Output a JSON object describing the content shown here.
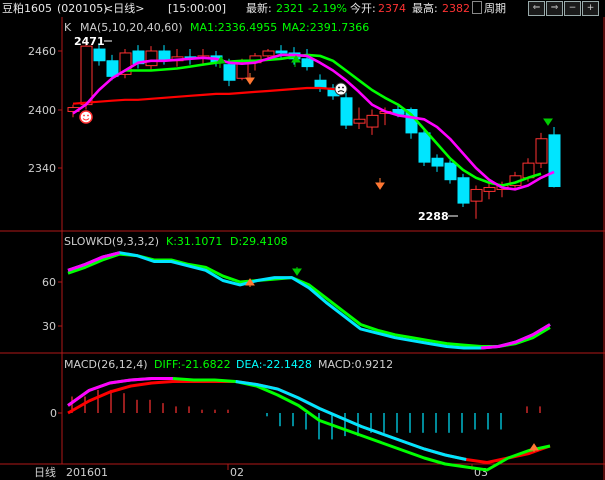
{
  "header": {
    "title": "豆粕1605",
    "code": "(020105)",
    "period": "<日线>",
    "time": "[15:00:00]",
    "latest_label": "最新:",
    "latest": "2321",
    "change": "-2.19%",
    "open_label": "今开:",
    "open": "2374",
    "high_label": "最高:",
    "high": "2382",
    "period_button": "周期"
  },
  "colors": {
    "up": "#ff3232",
    "down": "#00e5ff",
    "ma1": "#ff00ff",
    "ma2": "#ff0000",
    "ma3": "#00ff00",
    "frame": "#b01818",
    "text": "#cfcfcf",
    "green_text": "#00ff00",
    "red_text": "#ff3232"
  },
  "main_panel": {
    "legend_k": "K",
    "legend_ma": "MA(5,10,20,40,60)",
    "ma1_text": "MA1:2336.4955",
    "ma2_text": "MA2:2391.7366",
    "yticks": [
      2460,
      2400,
      2340
    ],
    "high_mark": "2471",
    "low_mark": "2288",
    "icons": [
      "smile-face-icon",
      "frown-face-icon"
    ]
  },
  "kd_panel": {
    "legend": "SLOWKD(9,3,3,2)",
    "k_text": "K:31.1071",
    "d_text": "D:29.4108",
    "yticks": [
      60,
      30
    ]
  },
  "macd_panel": {
    "legend": "MACD(26,12,4)",
    "diff_text": "DIFF:-21.6822",
    "dea_text": "DEA:-22.1428",
    "macd_text": "MACD:0.9212",
    "yticks": [
      0
    ]
  },
  "date_axis": {
    "mode_label": "日线",
    "labels": [
      "201601",
      "02",
      "03"
    ]
  },
  "chart_data": {
    "type": "candlestick",
    "candles": [
      {
        "o": 2398,
        "h": 2405,
        "l": 2392,
        "c": 2402
      },
      {
        "o": 2405,
        "h": 2471,
        "l": 2400,
        "c": 2465
      },
      {
        "o": 2462,
        "h": 2468,
        "l": 2445,
        "c": 2450
      },
      {
        "o": 2450,
        "h": 2456,
        "l": 2430,
        "c": 2434
      },
      {
        "o": 2436,
        "h": 2462,
        "l": 2432,
        "c": 2458
      },
      {
        "o": 2460,
        "h": 2466,
        "l": 2442,
        "c": 2447
      },
      {
        "o": 2445,
        "h": 2465,
        "l": 2440,
        "c": 2460
      },
      {
        "o": 2460,
        "h": 2466,
        "l": 2446,
        "c": 2450
      },
      {
        "o": 2450,
        "h": 2462,
        "l": 2444,
        "c": 2454
      },
      {
        "o": 2454,
        "h": 2462,
        "l": 2446,
        "c": 2452
      },
      {
        "o": 2453,
        "h": 2462,
        "l": 2445,
        "c": 2455
      },
      {
        "o": 2455,
        "h": 2460,
        "l": 2444,
        "c": 2448
      },
      {
        "o": 2446,
        "h": 2452,
        "l": 2424,
        "c": 2430
      },
      {
        "o": 2432,
        "h": 2452,
        "l": 2430,
        "c": 2448
      },
      {
        "o": 2448,
        "h": 2458,
        "l": 2440,
        "c": 2455
      },
      {
        "o": 2455,
        "h": 2462,
        "l": 2450,
        "c": 2460
      },
      {
        "o": 2460,
        "h": 2466,
        "l": 2452,
        "c": 2458
      },
      {
        "o": 2458,
        "h": 2464,
        "l": 2446,
        "c": 2452
      },
      {
        "o": 2452,
        "h": 2462,
        "l": 2440,
        "c": 2444
      },
      {
        "o": 2430,
        "h": 2436,
        "l": 2418,
        "c": 2422
      },
      {
        "o": 2422,
        "h": 2426,
        "l": 2410,
        "c": 2414
      },
      {
        "o": 2412,
        "h": 2418,
        "l": 2380,
        "c": 2384
      },
      {
        "o": 2386,
        "h": 2402,
        "l": 2380,
        "c": 2390
      },
      {
        "o": 2382,
        "h": 2400,
        "l": 2374,
        "c": 2394
      },
      {
        "o": 2396,
        "h": 2402,
        "l": 2384,
        "c": 2398
      },
      {
        "o": 2400,
        "h": 2406,
        "l": 2392,
        "c": 2395
      },
      {
        "o": 2400,
        "h": 2402,
        "l": 2370,
        "c": 2376
      },
      {
        "o": 2376,
        "h": 2380,
        "l": 2342,
        "c": 2346
      },
      {
        "o": 2350,
        "h": 2354,
        "l": 2336,
        "c": 2342
      },
      {
        "o": 2345,
        "h": 2348,
        "l": 2324,
        "c": 2328
      },
      {
        "o": 2330,
        "h": 2334,
        "l": 2300,
        "c": 2304
      },
      {
        "o": 2306,
        "h": 2322,
        "l": 2288,
        "c": 2318
      },
      {
        "o": 2316,
        "h": 2326,
        "l": 2308,
        "c": 2320
      },
      {
        "o": 2318,
        "h": 2326,
        "l": 2310,
        "c": 2322
      },
      {
        "o": 2322,
        "h": 2336,
        "l": 2318,
        "c": 2332
      },
      {
        "o": 2330,
        "h": 2350,
        "l": 2326,
        "c": 2345
      },
      {
        "o": 2345,
        "h": 2376,
        "l": 2340,
        "c": 2370
      },
      {
        "o": 2374,
        "h": 2382,
        "l": 2320,
        "c": 2321
      }
    ],
    "ma1": [
      2396,
      2405,
      2420,
      2432,
      2440,
      2448,
      2450,
      2450,
      2451,
      2452,
      2453,
      2452,
      2448,
      2447,
      2448,
      2452,
      2456,
      2456,
      2455,
      2448,
      2440,
      2430,
      2418,
      2405,
      2398,
      2394,
      2392,
      2390,
      2382,
      2370,
      2355,
      2340,
      2328,
      2320,
      2318,
      2322,
      2330,
      2336
    ],
    "ma2": [
      2406,
      2407,
      2408,
      2409,
      2410,
      2410,
      2411,
      2412,
      2413,
      2414,
      2415,
      2416,
      2416,
      2417,
      2418,
      2419,
      2420,
      2421,
      2422,
      2422,
      2421,
      2420
    ],
    "ma3": [
      2440,
      2440,
      2440,
      2441,
      2442,
      2444,
      2446,
      2448,
      2449,
      2450,
      2450,
      2451,
      2452,
      2454,
      2456,
      2455,
      2450,
      2440,
      2430,
      2420,
      2412,
      2405,
      2395,
      2380,
      2365,
      2350,
      2338,
      2330,
      2325,
      2322,
      2325,
      2330,
      2334
    ],
    "kd_k": [
      68,
      72,
      77,
      80,
      78,
      74,
      74,
      71,
      68,
      61,
      58,
      61,
      63,
      63,
      56,
      46,
      37,
      28,
      25,
      22,
      20,
      18,
      16,
      15,
      15,
      16,
      19,
      24,
      31
    ],
    "kd_d": [
      66,
      70,
      75,
      79,
      78,
      75,
      75,
      72,
      70,
      64,
      60,
      61,
      62,
      63,
      58,
      49,
      40,
      31,
      27,
      24,
      22,
      20,
      18,
      17,
      16,
      16,
      18,
      22,
      29
    ],
    "macd_diff": [
      5,
      15,
      20,
      22,
      23,
      23,
      22,
      22,
      21,
      18,
      12,
      5,
      -5,
      -10,
      -15,
      -20,
      -25,
      -30,
      -34,
      -36,
      -38,
      -30,
      -25,
      -22
    ],
    "macd_dea": [
      0,
      8,
      14,
      18,
      20,
      21,
      21,
      21,
      21,
      19,
      16,
      10,
      3,
      -3,
      -9,
      -14,
      -19,
      -24,
      -28,
      -31,
      -33,
      -30,
      -27,
      -22
    ]
  }
}
